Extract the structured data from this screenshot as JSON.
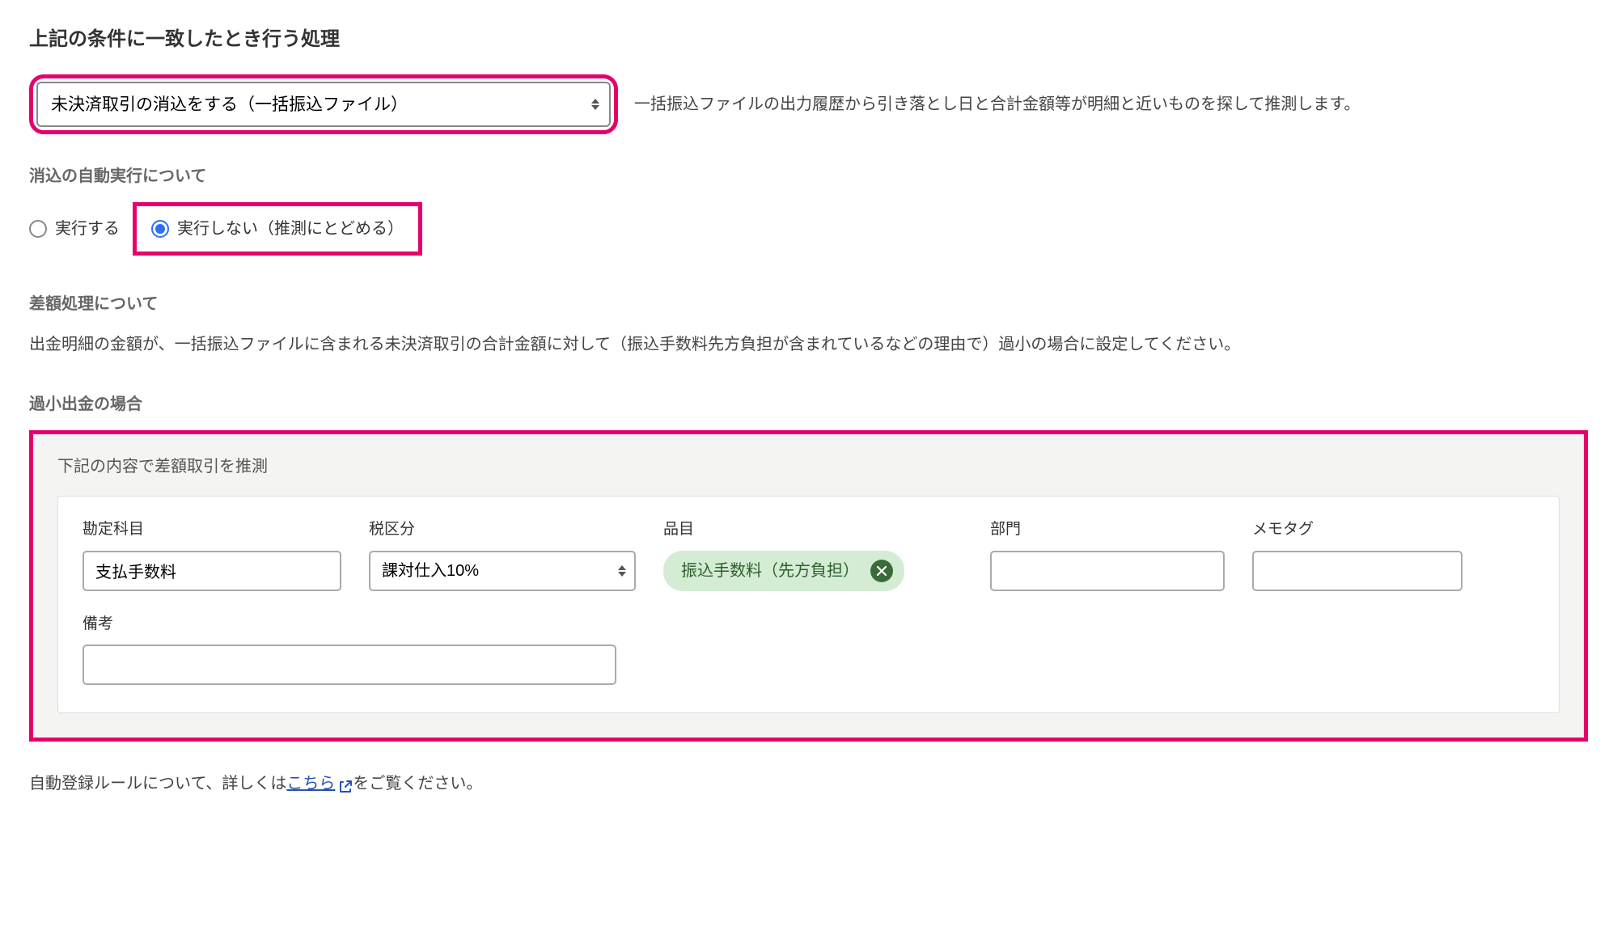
{
  "heading": "上記の条件に一致したとき行う処理",
  "action_select": {
    "value": "未決済取引の消込をする（一括振込ファイル）",
    "description": "一括振込ファイルの出力履歴から引き落とし日と合計金額等が明細と近いものを探して推測します。"
  },
  "auto_exec": {
    "heading": "消込の自動実行について",
    "options": {
      "execute": "実行する",
      "no_execute": "実行しない（推測にとどめる）"
    }
  },
  "diff": {
    "heading": "差額処理について",
    "body": "出金明細の金額が、一括振込ファイルに含まれる未決済取引の合計金額に対して（振込手数料先方負担が含まれているなどの理由で）過小の場合に設定してください。"
  },
  "undersized": {
    "heading": "過小出金の場合",
    "panel_title": "下記の内容で差額取引を推測",
    "fields": {
      "account": {
        "label": "勘定科目",
        "value": "支払手数料"
      },
      "tax": {
        "label": "税区分",
        "value": "課対仕入10%"
      },
      "item": {
        "label": "品目",
        "tag": "振込手数料（先方負担）"
      },
      "dept": {
        "label": "部門",
        "value": ""
      },
      "memotag": {
        "label": "メモタグ",
        "value": ""
      },
      "remark": {
        "label": "備考",
        "value": ""
      }
    }
  },
  "footer": {
    "prefix": "自動登録ルールについて、詳しくは",
    "link": "こちら",
    "suffix": "をご覧ください。"
  }
}
